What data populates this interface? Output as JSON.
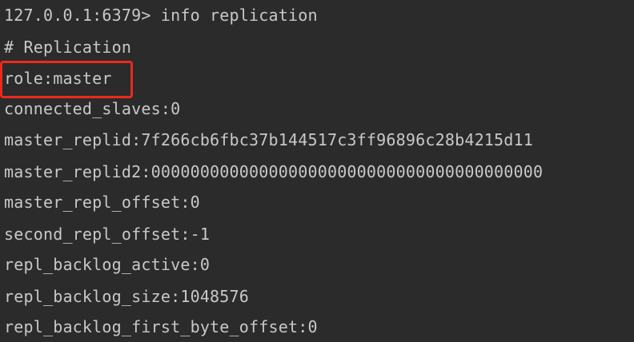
{
  "terminal": {
    "prompt_line": "127.0.0.1:6379> info replication",
    "lines": [
      "# Replication",
      "role:master",
      "connected_slaves:0",
      "master_replid:7f266cb6fbc37b144517c3ff96896c28b4215d11",
      "master_replid2:0000000000000000000000000000000000000000",
      "master_repl_offset:0",
      "second_repl_offset:-1",
      "repl_backlog_active:0",
      "repl_backlog_size:1048576",
      "repl_backlog_first_byte_offset:0"
    ],
    "highlight_color": "#ea2a1e",
    "text_color": "#c8c8c8",
    "background_color": "#2b2b2b"
  }
}
